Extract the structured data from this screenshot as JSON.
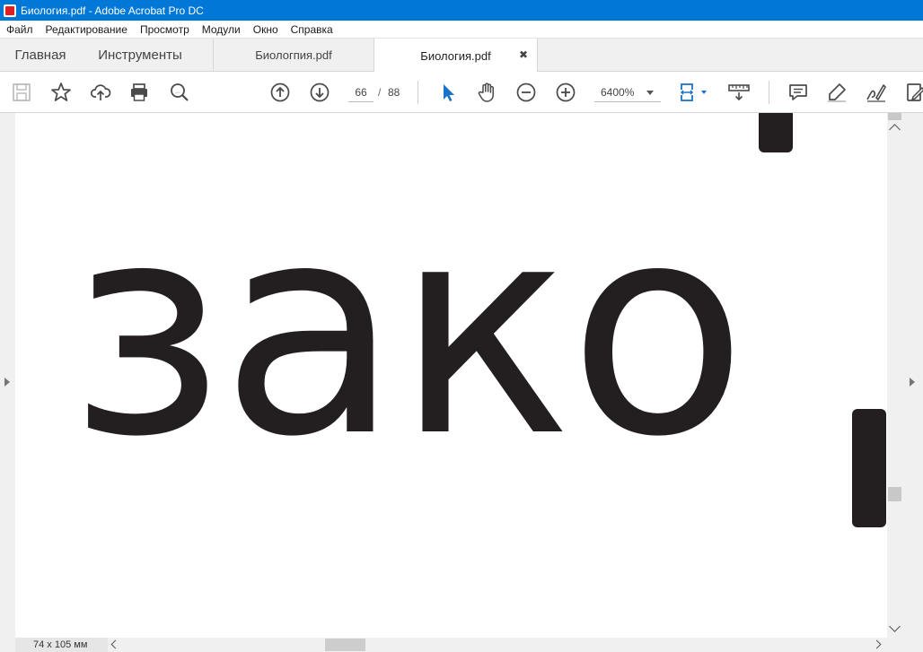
{
  "window": {
    "title": "Биология.pdf - Adobe Acrobat Pro DC"
  },
  "menu": [
    "Файл",
    "Редактирование",
    "Просмотр",
    "Модули",
    "Окно",
    "Справка"
  ],
  "tabs": {
    "home": "Главная",
    "tools": "Инструменты",
    "documents": [
      {
        "label": "Биологпия.pdf",
        "active": false
      },
      {
        "label": "Биология.pdf",
        "active": true
      }
    ]
  },
  "toolbar": {
    "icons": [
      "save-icon",
      "bookmark-star-icon",
      "cloud-upload-icon",
      "print-icon",
      "find-text-icon",
      "page-up-icon",
      "page-down-icon",
      "select-cursor-icon",
      "hand-icon",
      "zoom-out-icon",
      "zoom-in-icon",
      "page-fit-icon",
      "ruler-icon",
      "comment-icon",
      "highlight-pen-icon",
      "sign-icon",
      "edit-pdf-icon"
    ],
    "current_page": "66",
    "page_separator": "/",
    "total_pages": "88",
    "zoom": "6400%"
  },
  "document": {
    "visible_text": "зако"
  },
  "status": {
    "page_size": "74 x 105 мм"
  },
  "colors": {
    "titlebar": "#0078d7",
    "accent": "#1a73c9",
    "text_glyph": "#231f20"
  }
}
